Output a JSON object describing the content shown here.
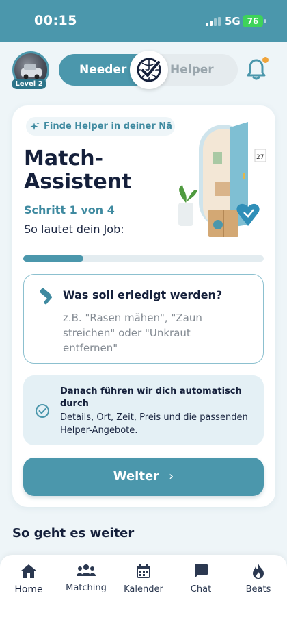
{
  "status_bar": {
    "time": "00:15",
    "network": "5G",
    "battery": "76"
  },
  "header": {
    "level_badge": "Level 2",
    "toggle": {
      "left_label": "Needer",
      "right_label": "Helper",
      "selected": "Needer"
    },
    "notification_dot": true
  },
  "card": {
    "pill_text": "Finde Helper in deiner Nä",
    "title": "Match-Assistent",
    "step": "Schritt 1 von 4",
    "subtitle": "So lautet dein Job:",
    "progress": 0.25,
    "question": {
      "title": "Was soll erledigt werden?",
      "placeholder": "z.B. \"Rasen mähen\", \"Zaun streichen\" oder \"Unkraut entfernen\""
    },
    "info": {
      "title": "Danach führen wir dich automatisch durch",
      "text": "Details, Ort, Zeit, Preis und die passenden Helper-Angebote."
    },
    "button": {
      "label": "Weiter",
      "chevron": "›"
    }
  },
  "section_title": "So geht es weiter",
  "nav": {
    "items": [
      {
        "label": "Home",
        "icon": "home-icon",
        "active": true
      },
      {
        "label": "Matching",
        "icon": "people-icon"
      },
      {
        "label": "Kalender",
        "icon": "calendar-icon"
      },
      {
        "label": "Chat",
        "icon": "chat-icon"
      },
      {
        "label": "Beats",
        "icon": "flame-icon"
      }
    ]
  },
  "colors": {
    "primary": "#4b97ac",
    "dark": "#15203b",
    "background": "#eef5f8",
    "accent_dot": "#f0a43a"
  }
}
